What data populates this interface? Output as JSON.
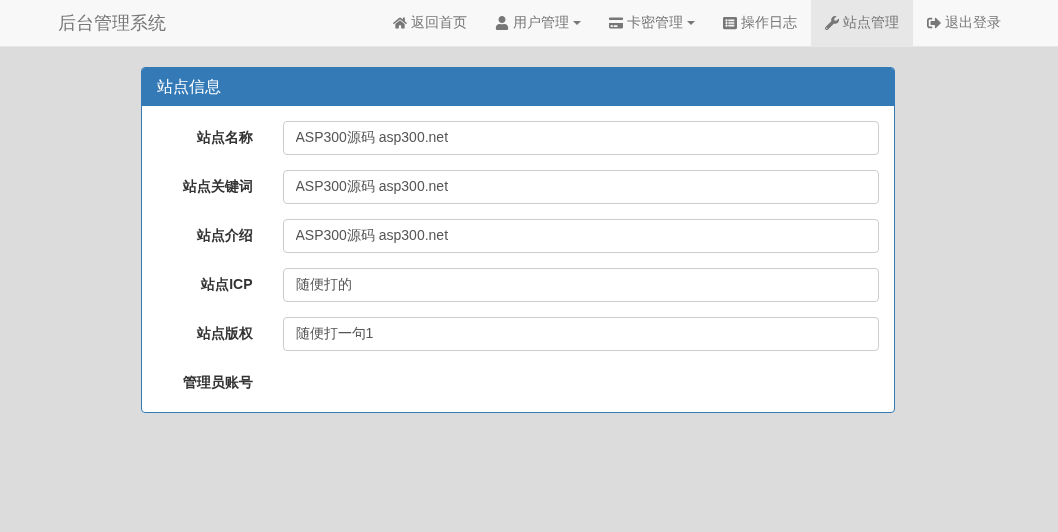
{
  "brand": "后台管理系统",
  "nav": [
    {
      "label": "返回首页",
      "selected": false,
      "has_menu": false
    },
    {
      "label": "用户管理",
      "selected": false,
      "has_menu": true
    },
    {
      "label": "卡密管理",
      "selected": false,
      "has_menu": true
    },
    {
      "label": "操作日志",
      "selected": false,
      "has_menu": false
    },
    {
      "label": "站点管理",
      "selected": true,
      "has_menu": false
    },
    {
      "label": "退出登录",
      "selected": false,
      "has_menu": false
    }
  ],
  "panel": {
    "title": "站点信息",
    "fields": [
      {
        "label": "站点名称",
        "value": "ASP300源码 asp300.net"
      },
      {
        "label": "站点关键词",
        "value": "ASP300源码 asp300.net"
      },
      {
        "label": "站点介绍",
        "value": "ASP300源码 asp300.net"
      },
      {
        "label": "站点ICP",
        "value": "随便打的"
      },
      {
        "label": "站点版权",
        "value": "随便打一句1"
      },
      {
        "label": "管理员账号"
      }
    ]
  }
}
